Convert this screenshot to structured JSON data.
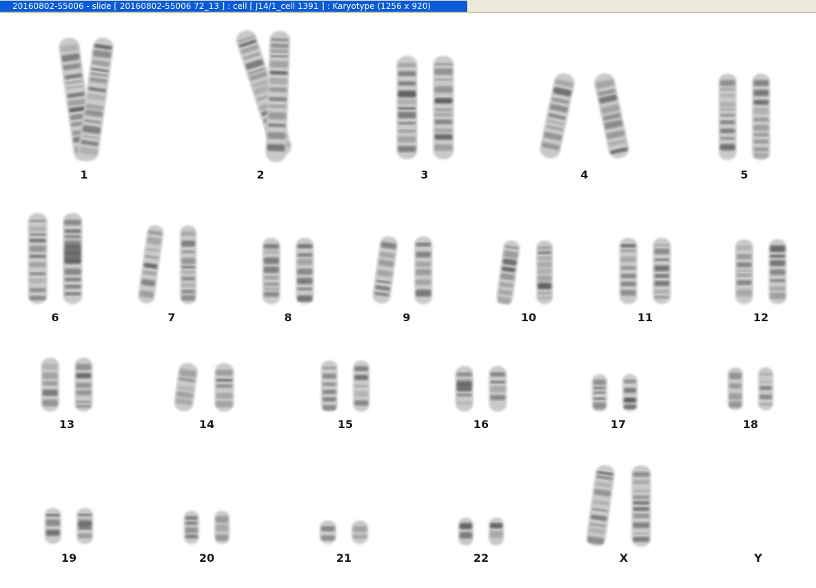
{
  "window": {
    "title": "20160802-55006 - slide [ 20160802-55006 72_13 ] : cell [ J14/1_cell 1391 ] : Karyotype  (1256 x 920)"
  },
  "karyotype": {
    "chromosomes": [
      {
        "label": "1"
      },
      {
        "label": "2"
      },
      {
        "label": "3"
      },
      {
        "label": "4"
      },
      {
        "label": "5"
      },
      {
        "label": "6"
      },
      {
        "label": "7"
      },
      {
        "label": "8"
      },
      {
        "label": "9"
      },
      {
        "label": "10"
      },
      {
        "label": "11"
      },
      {
        "label": "12"
      },
      {
        "label": "13"
      },
      {
        "label": "14"
      },
      {
        "label": "15"
      },
      {
        "label": "16"
      },
      {
        "label": "17"
      },
      {
        "label": "18"
      },
      {
        "label": "19"
      },
      {
        "label": "20"
      },
      {
        "label": "21"
      },
      {
        "label": "22"
      },
      {
        "label": "X"
      },
      {
        "label": "Y"
      }
    ]
  }
}
